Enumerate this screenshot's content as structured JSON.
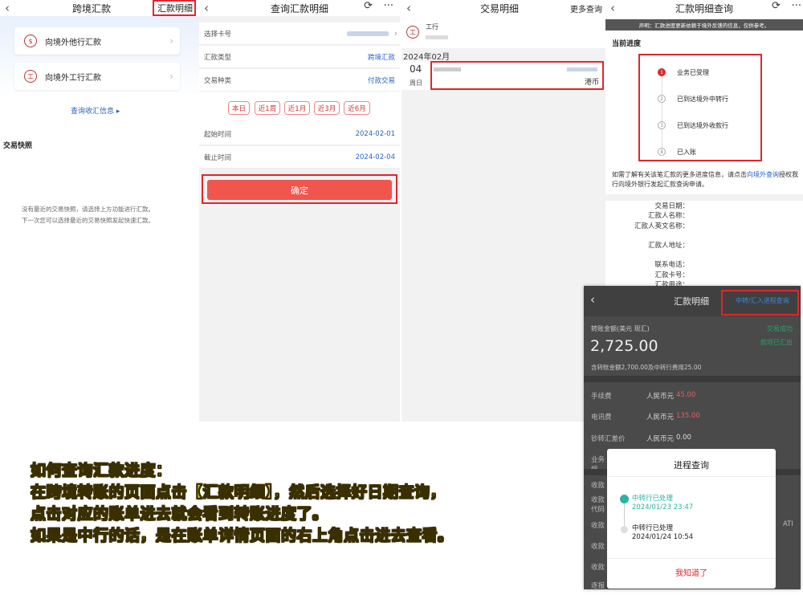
{
  "panel1": {
    "title": "跨境汇款",
    "top_right": "汇款明细",
    "cards": [
      {
        "label": "向境外他行汇款",
        "icon": "money-bag-icon"
      },
      {
        "label": "向境外工行汇款",
        "icon": "icbc-logo-icon"
      }
    ],
    "query_link": "查询收汇信息",
    "section": "交易快照",
    "empty_line1": "没有最近的交易快照，请选择上方功能进行汇款。",
    "empty_line2": "下一次您可以选择最近的交易快照发起快速汇款。"
  },
  "panel2": {
    "title": "查询汇款明细",
    "rows": [
      {
        "label": "选择卡号",
        "value": ""
      },
      {
        "label": "汇款类型",
        "value": "跨境汇款"
      },
      {
        "label": "交易种类",
        "value": "付款交易"
      }
    ],
    "chips": [
      "本日",
      "近1周",
      "近1月",
      "近3月",
      "近6月"
    ],
    "start_label": "起始时间",
    "start_value": "2024-02-01",
    "end_label": "截止时间",
    "end_value": "2024-02-04",
    "confirm": "确定"
  },
  "panel3": {
    "title": "交易明细",
    "more": "更多查询",
    "bank": "工行",
    "month": "2024年02月",
    "day": "04",
    "weekday": "周日",
    "currency": "港币"
  },
  "panel4": {
    "title": "汇款明细查询",
    "notice": "声明：汇款进度更新依赖于境外反馈的信息，仅供参考。",
    "progress_title": "当前进度",
    "steps": [
      "业务已受理",
      "已到达境外中转行",
      "已到达境外收款行",
      "已入账"
    ],
    "help_pre": "如需了解有关该笔汇款的更多进度信息，请点击",
    "help_link": "向境外查询",
    "help_post": "授权我行向境外银行发起汇款查询申请。",
    "fields": [
      "交易日期：",
      "汇款人名称：",
      "汇款人英文名称：",
      "汇款人地址：",
      "联系电话：",
      "汇款卡号：",
      "汇款用途："
    ]
  },
  "panel5": {
    "title": "汇款明细",
    "top_right": "中转/汇入进程查询",
    "amount_label": "转账金额(美元 现汇)",
    "status1": "交易成功",
    "status2": "款项已汇出",
    "amount": "2,725.00",
    "amount_note": "含转账金额2,700.00及中转行费用25.00",
    "fees": [
      {
        "label": "手续费",
        "value": "人民币元",
        "amount": "45.00"
      },
      {
        "label": "电讯费",
        "value": "人民币元",
        "amount": "135.00"
      },
      {
        "label": "钞转汇差价",
        "value": "人民币元",
        "amount": "0.00"
      }
    ],
    "dim_labels": [
      "业务编",
      "收款",
      "收款",
      "代码",
      "收款",
      "收款",
      "收款",
      "逐报"
    ],
    "dim_right": "ATI",
    "modal_title": "进程查询",
    "events": [
      {
        "label": "中转行已处理",
        "time": "2024/01/23 23:47"
      },
      {
        "label": "中转行已处理",
        "time": "2024/01/24 10:54"
      }
    ],
    "modal_button": "我知道了"
  },
  "caption": [
    "如何查询汇款进度：",
    "在跨境转账的页面点击【汇款明细】，然后选择好日期查询，",
    "点击对应的账单进去就会看到转账进度了。",
    "如果是中行的话，是在账单详情页面的右上角点击进去查看。"
  ],
  "colors": {
    "accent_red": "#e0262b",
    "link_blue": "#2a62c9",
    "caption_yellow": "#f3c61a",
    "success_green": "#2aa36b",
    "teal": "#26b5a2"
  }
}
